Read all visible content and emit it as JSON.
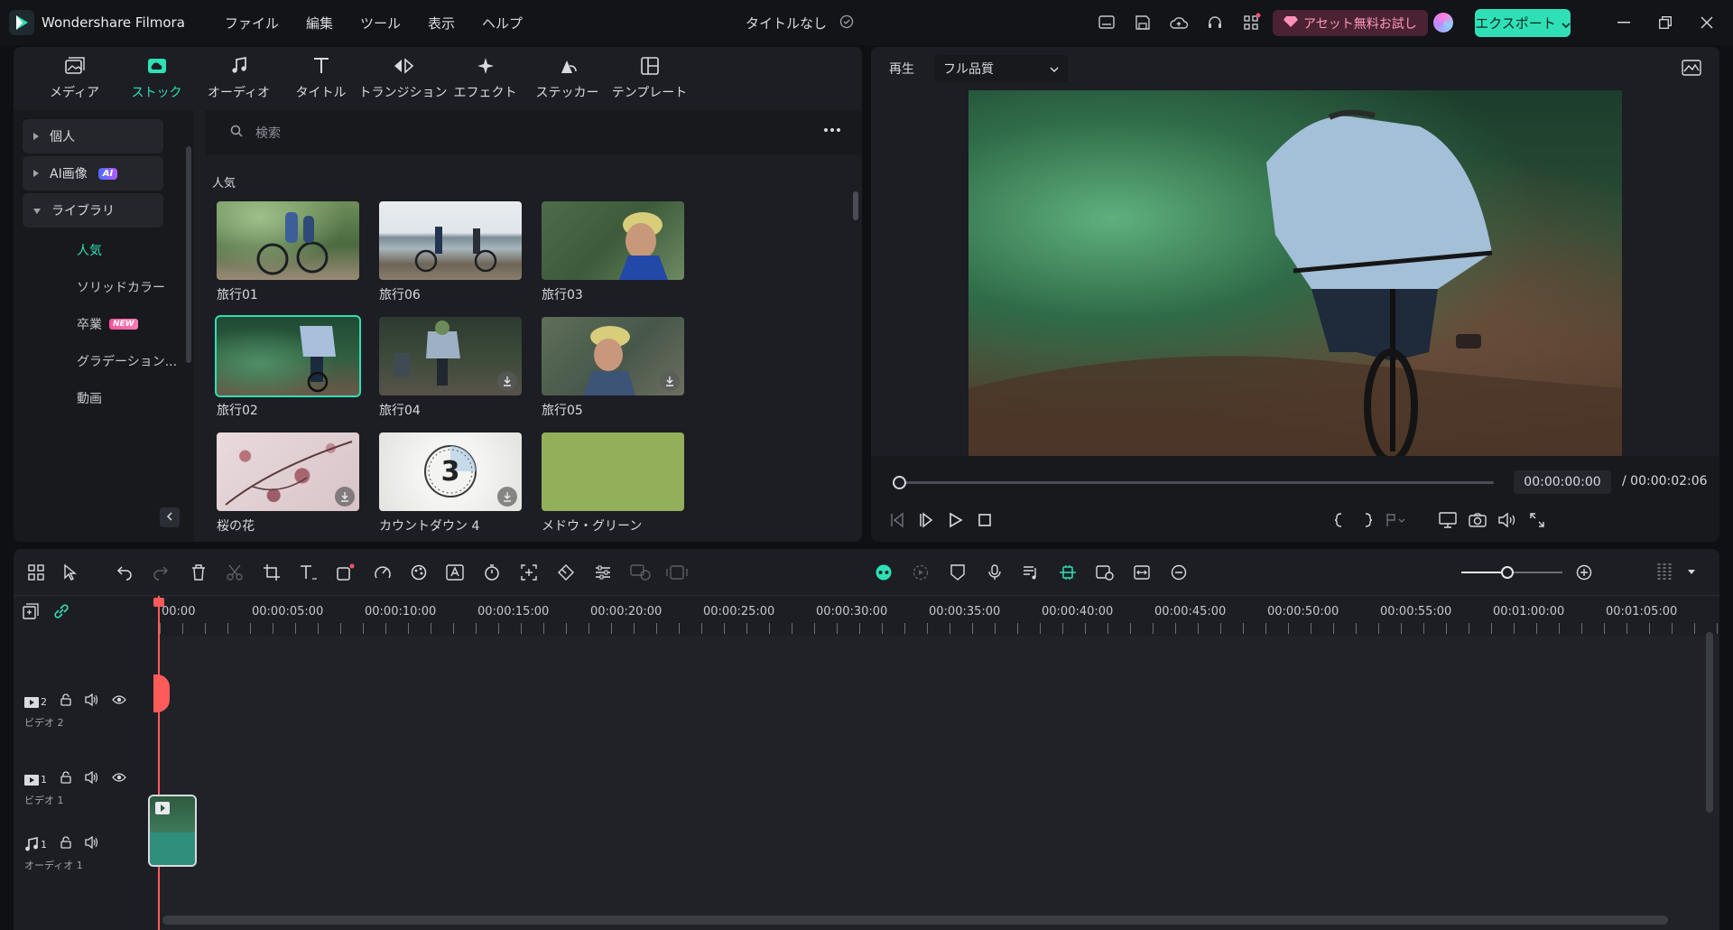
{
  "app": {
    "name": "Wondershare Filmora",
    "doc_title": "タイトルなし"
  },
  "menu": [
    "ファイル",
    "編集",
    "ツール",
    "表示",
    "ヘルプ"
  ],
  "header": {
    "trial_label": "アセット無料お試し",
    "export_label": "エクスポート"
  },
  "tabs": [
    "メディア",
    "ストック",
    "オーディオ",
    "タイトル",
    "トランジション",
    "エフェクト",
    "ステッカー",
    "テンプレート"
  ],
  "sidebar": {
    "groups": [
      {
        "label": "個人"
      },
      {
        "label": "AI画像",
        "badge": "AI"
      },
      {
        "label": "ライブラリ"
      }
    ],
    "subitems": [
      {
        "label": "人気"
      },
      {
        "label": "ソリッドカラー"
      },
      {
        "label": "卒業",
        "badge": "NEW"
      },
      {
        "label": "グラデーション..."
      },
      {
        "label": "動画"
      }
    ]
  },
  "search": {
    "placeholder": "検索"
  },
  "section": {
    "label": "人気"
  },
  "thumbnails": [
    "旅行01",
    "旅行06",
    "旅行03",
    "旅行02",
    "旅行04",
    "旅行05",
    "桜の花",
    "カウントダウン 4",
    "メドウ・グリーン"
  ],
  "countdown_digit": "3",
  "preview": {
    "play_label": "再生",
    "quality": "フル品質",
    "current_time": "00:00:00:00",
    "total_time": "/ 00:00:02:06",
    "progress": 0
  },
  "ruler": [
    "00:00",
    "00:00:05:00",
    "00:00:10:00",
    "00:00:15:00",
    "00:00:20:00",
    "00:00:25:00",
    "00:00:30:00",
    "00:00:35:00",
    "00:00:40:00",
    "00:00:45:00",
    "00:00:50:00",
    "00:00:55:00",
    "00:01:00:00",
    "00:01:05:00"
  ],
  "tracks": [
    {
      "num": "2",
      "name": "ビデオ 2"
    },
    {
      "num": "1",
      "name": "ビデオ 1"
    },
    {
      "num": "1",
      "name": "オーディオ 1"
    }
  ],
  "colors": {
    "accent": "#2fe0b6",
    "playhead": "#ff5b5b",
    "meadow_green": "#93af5a"
  }
}
